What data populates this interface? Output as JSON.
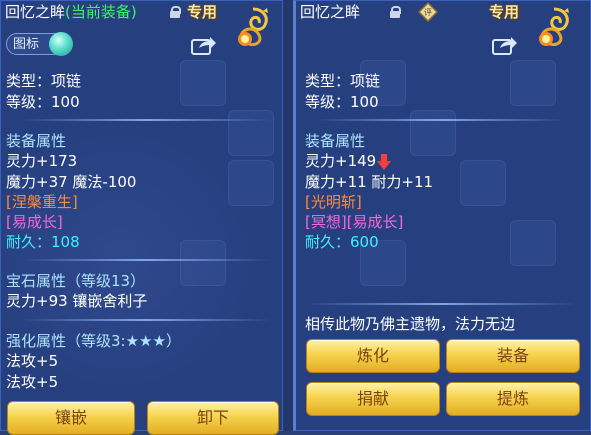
{
  "left_panel": {
    "title_name": "回忆之眸",
    "title_current": "(当前装备)",
    "special_label": "专用",
    "icon_badge_label": "图标",
    "type_line": "类型：项链",
    "level_line": "等级：100",
    "attr_header": "装备属性",
    "attr_lines": [
      "灵力+173",
      "魔力+37 魔法-100"
    ],
    "special_skill": "[涅槃重生]",
    "special_effect": "[易成长]",
    "durability": "耐久：108",
    "gem_header": "宝石属性（等级13）",
    "gem_line": "灵力+93 镶嵌舍利子",
    "enhance_header": "强化属性（等级3:★★★）",
    "enhance_lines": [
      "法攻+5",
      "法攻+5"
    ],
    "buttons": [
      "镶嵌",
      "卸下"
    ]
  },
  "right_panel": {
    "title_name": "回忆之眸",
    "special_label": "专用",
    "type_line": "类型：项链",
    "level_line": "等级：100",
    "attr_header": "装备属性",
    "attr_line1": "灵力+149",
    "attr_line2": "魔力+11 耐力+11",
    "special_skill": "[光明斩]",
    "special_effect": "[冥想][易成长]",
    "durability": "耐久：600",
    "description": "相传此物乃佛主遗物，法力无边",
    "buttons": [
      "炼化",
      "装备",
      "捐献",
      "提炼"
    ]
  }
}
